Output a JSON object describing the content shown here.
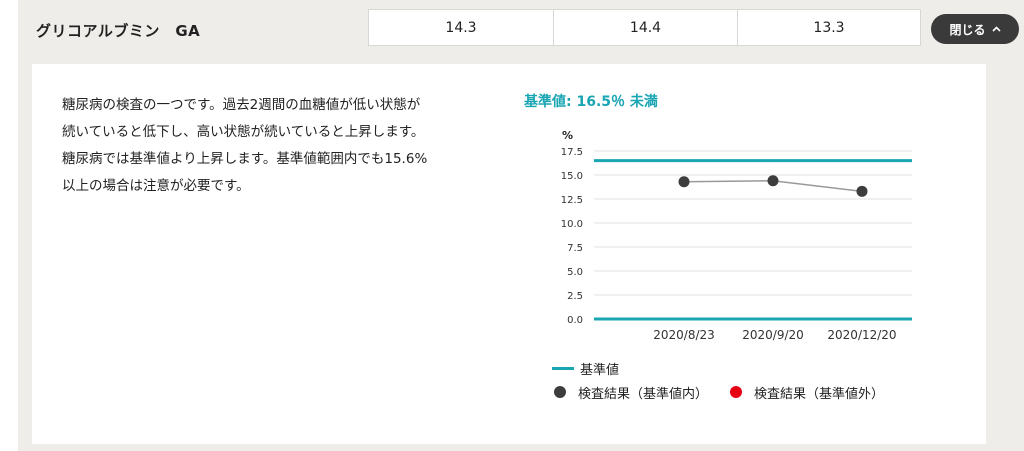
{
  "row": {
    "label": "グリコアルブミン　GA",
    "values": [
      "14.3",
      "14.4",
      "13.3"
    ],
    "close_label": "閉じる",
    "close_icon": "chevron-up-icon"
  },
  "description": [
    "糖尿病の検査の一つです。過去2週間の血糖値が低い状態が",
    "続いていると低下し、高い状態が続いていると上昇します。",
    "糖尿病では基準値より上昇します。基準値範囲内でも15.6%",
    "以上の場合は注意が必要です。"
  ],
  "standard_title": "基準値: 16.5％ 未満",
  "legend": {
    "standard": "基準値",
    "in_range": "検査結果（基準値内）",
    "out_range": "検査結果（基準値外）"
  },
  "colors": {
    "standard_line": "#1aa5b3",
    "in_range": "#3d3d3d",
    "out_range": "#e60012",
    "result_line": "#999999"
  },
  "chart_data": {
    "type": "line",
    "ylabel": "%",
    "ylim": [
      0,
      17.5
    ],
    "yticks": [
      "0.0",
      "2.5",
      "5.0",
      "7.5",
      "10.0",
      "12.5",
      "15.0",
      "17.5"
    ],
    "categories": [
      "2020/8/23",
      "2020/9/20",
      "2020/12/20"
    ],
    "series": [
      {
        "name": "検査結果（基準値内）",
        "values": [
          14.3,
          14.4,
          13.3
        ]
      }
    ],
    "reference_lines": [
      {
        "name": "基準値",
        "value": 16.5
      },
      {
        "value": 0
      }
    ],
    "grid": true
  }
}
